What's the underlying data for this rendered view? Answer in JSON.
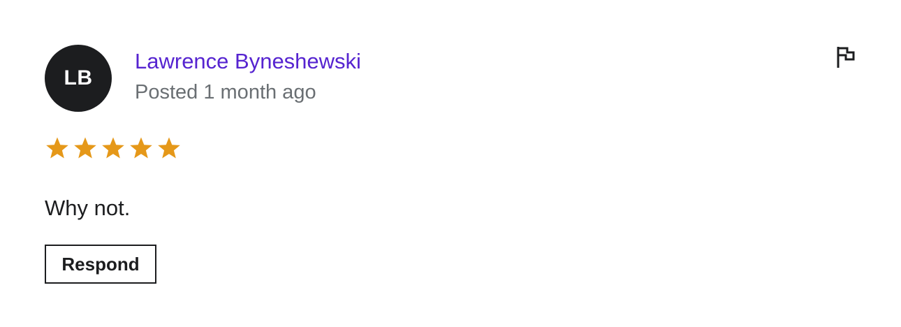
{
  "review": {
    "avatar_initials": "LB",
    "author_name": "Lawrence Byneshewski",
    "posted_text": "Posted 1 month ago",
    "rating": 5,
    "rating_max": 5,
    "text": "Why not.",
    "respond_label": "Respond",
    "report_icon": "flag-icon"
  },
  "colors": {
    "author_link": "#5624d0",
    "star": "#e59819",
    "text": "#1c1d1f",
    "muted": "#6a6f73",
    "avatar_bg": "#1c1d1f"
  }
}
